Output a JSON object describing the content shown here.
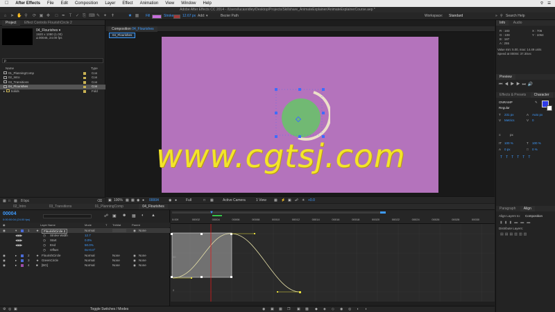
{
  "menubar": {
    "apple": "",
    "app": "After Effects",
    "items": [
      "File",
      "Edit",
      "Composition",
      "Layer",
      "Effect",
      "Animation",
      "View",
      "Window",
      "Help"
    ]
  },
  "titlebar": {
    "title": "Adobe After Effects CC 2014 - /Users/lucasridley/Desktop/Projects/Skillshare_AnimateExplainer/AnimateExplainerCourse.aep *"
  },
  "toolbar": {
    "fill_label": "Fill",
    "stroke_label": "Stroke",
    "stroke_width": "12.67 px",
    "add_label": "Add:",
    "bezier_label": "Bezier Path",
    "workspace_label": "Workspace:",
    "workspace_value": "Standard",
    "search_placeholder": "Search Help",
    "fill_color": "#c86fdc",
    "stroke_color": "#a13a3a"
  },
  "project": {
    "tab_project": "Project",
    "tab_effect_controls": "Effect Controls FlourishCircle 2",
    "selected_item": "04_Flourishes ▾",
    "selected_info_1": "1920 x 1080 (1.00)",
    "selected_info_2": "Δ 00046, 24.00 fps",
    "search_placeholder": "ρ",
    "col_name": "Name",
    "col_type": "Type",
    "items": [
      {
        "name": "01_PlanningComp",
        "type": "Con"
      },
      {
        "name": "02_Intro",
        "type": "Con"
      },
      {
        "name": "03_Transitions",
        "type": "Con"
      },
      {
        "name": "04_Flourishes",
        "type": "Con"
      },
      {
        "name": "Solids",
        "type": "Fold"
      }
    ],
    "bpc": "8 bpc"
  },
  "viewer": {
    "tab_label": "Composition",
    "tab_comp": "04_Flourishes",
    "crumb": "04_Flourishes",
    "zoom": "100%",
    "timecode": "00004",
    "resolution": "Full",
    "camera": "Active Camera",
    "views": "1 View",
    "exposure": "+0.0"
  },
  "watermark": "www.cgtsj.com",
  "timeline": {
    "tabs": [
      "02_Intro",
      "03_Transitions",
      "01_PlanningComp",
      "04_Flourishes"
    ],
    "current_time": "00004",
    "fps_info": "0:00:00:04 (24.00 fps)",
    "col_layer_name": "Layer Name",
    "col_mode": "Mode",
    "col_t": "T",
    "col_trkmat": "TrkMat",
    "col_parent": "Parent",
    "layers": [
      {
        "num": "1",
        "name": "FlourishCircle 2",
        "mode": "Normal",
        "trkmat": "",
        "parent": "None",
        "color": "#4a6bd6"
      },
      {
        "num": "2",
        "name": "FlourishCircle",
        "mode": "Normal",
        "trkmat": "None",
        "parent": "None",
        "color": "#4a6bd6"
      },
      {
        "num": "3",
        "name": "GreenCircle",
        "mode": "Normal",
        "trkmat": "None",
        "parent": "None",
        "color": "#4a6bd6"
      },
      {
        "num": "4",
        "name": "[BG]",
        "mode": "Normal",
        "trkmat": "None",
        "parent": "None",
        "color": "#9d4ea8"
      }
    ],
    "props": [
      {
        "name": "Stroke Width",
        "value": "12.7"
      },
      {
        "name": "Start",
        "value": "0.0%"
      },
      {
        "name": "End",
        "value": "50.0%"
      },
      {
        "name": "Offset",
        "value": "0x+0.0°"
      }
    ],
    "ruler_labels": [
      "0:00f",
      "00002",
      "00004",
      "00006",
      "00008",
      "00010",
      "00012",
      "00014",
      "00016",
      "00018",
      "00020",
      "00022",
      "00024",
      "00026",
      "00028",
      "00030"
    ],
    "graph_y_labels": [
      "50",
      "0"
    ],
    "footer_label": "Toggle Switches / Modes"
  },
  "info": {
    "tab_info": "Info",
    "tab_audio": "Audio",
    "r": "R : 183",
    "g": "G : 108",
    "b": "B : 187",
    "a": "A : 255",
    "x": "X : 706",
    "y": "Y : 1064",
    "status_1": "Value min: 5.00, max: 14.49 units",
    "status_2": "Speed at 00004: 37.3/sec"
  },
  "preview": {
    "tab": "Preview"
  },
  "character": {
    "tab_effects": "Effects & Presets",
    "tab_character": "Character",
    "font": "ONRAMP",
    "style": "Regular",
    "size": "231 px",
    "leading": "Auto px",
    "kerning": "Metrics",
    "tracking": "0",
    "stroke_unit": "px",
    "v_scale": "100 %",
    "h_scale": "100 %",
    "baseline": "0 px",
    "tsume": "0 %",
    "fill_color": "#2d3be8"
  },
  "align": {
    "tab_paragraph": "Paragraph",
    "tab_align": "Align",
    "align_to_label": "Align Layers to:",
    "align_to_value": "Composition",
    "distribute_label": "Distribute Layers:"
  }
}
